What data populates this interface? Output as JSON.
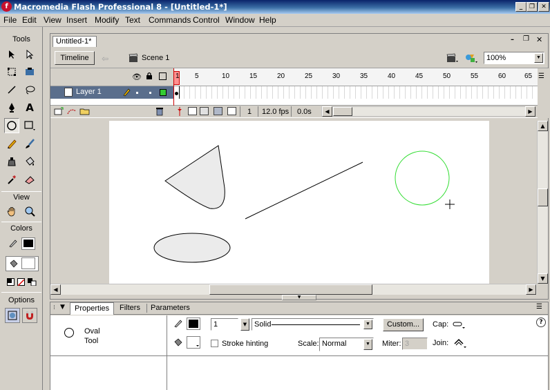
{
  "app": {
    "title": "Macromedia Flash Professional 8 - [Untitled-1*]",
    "icon_letter": "f"
  },
  "menu": [
    "File",
    "Edit",
    "View",
    "Insert",
    "Modify",
    "Text",
    "Commands",
    "Control",
    "Window",
    "Help"
  ],
  "tools": {
    "header": "Tools",
    "view_header": "View",
    "colors_header": "Colors",
    "options_header": "Options",
    "stroke_color": "#000000",
    "fill_color": "#ffffff"
  },
  "document": {
    "tab_label": "Untitled-1*",
    "timeline_button": "Timeline",
    "scene_label": "Scene 1",
    "zoom": "100%"
  },
  "timeline": {
    "layer_name": "Layer 1",
    "frame_numbers": [
      "1",
      "5",
      "10",
      "15",
      "20",
      "25",
      "30",
      "35",
      "40",
      "45",
      "50",
      "55",
      "60",
      "65"
    ],
    "current_frame": "1",
    "frame_rate": "12.0 fps",
    "elapsed_time": "0.0s"
  },
  "properties": {
    "tabs": [
      "Properties",
      "Filters",
      "Parameters"
    ],
    "tool_name_line1": "Oval",
    "tool_name_line2": "Tool",
    "stroke_height": "1",
    "stroke_style": "Solid",
    "custom_button": "Custom...",
    "cap_label": "Cap:",
    "stroke_hinting_label": "Stroke hinting",
    "scale_label": "Scale:",
    "scale_value": "Normal",
    "miter_label": "Miter:",
    "miter_value": "3",
    "join_label": "Join:",
    "help_icon_text": "?"
  },
  "colors": {
    "titlebar_start": "#0a246a",
    "titlebar_end": "#a6caf0",
    "playhead": "#cc0000",
    "circle_stroke": "#33dd33",
    "shape_fill": "#ebebeb"
  }
}
